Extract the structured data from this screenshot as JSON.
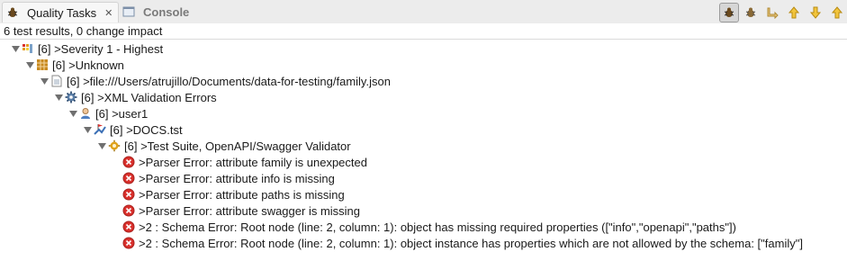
{
  "tabs": {
    "quality_tasks": "Quality Tasks",
    "console": "Console",
    "close": "✕"
  },
  "summary": "6 test results, 0 change impact",
  "tree": {
    "severity": "[6] >Severity 1 - Highest",
    "unknown": "[6] >Unknown",
    "file": "[6] >file:///Users/atrujillo/Documents/data-for-testing/family.json",
    "xml": "[6] >XML Validation Errors",
    "user": "[6] >user1",
    "docs": "[6] >DOCS.tst",
    "suite": "[6] >Test Suite, OpenAPI/Swagger Validator",
    "errors": [
      ">Parser Error: attribute family is unexpected",
      ">Parser Error: attribute info is missing",
      ">Parser Error: attribute paths is missing",
      ">Parser Error: attribute swagger is missing",
      ">2 : Schema Error: Root node (line: 2, column: 1): object has missing required properties ([\"info\",\"openapi\",\"paths\"])",
      ">2 : Schema Error: Root node (line: 2, column: 1): object instance has properties which are not allowed by the schema: [\"family\"]"
    ]
  },
  "colors": {
    "error": "#d9302c",
    "folder": "#c8891f",
    "suite": "#e0a21a"
  }
}
